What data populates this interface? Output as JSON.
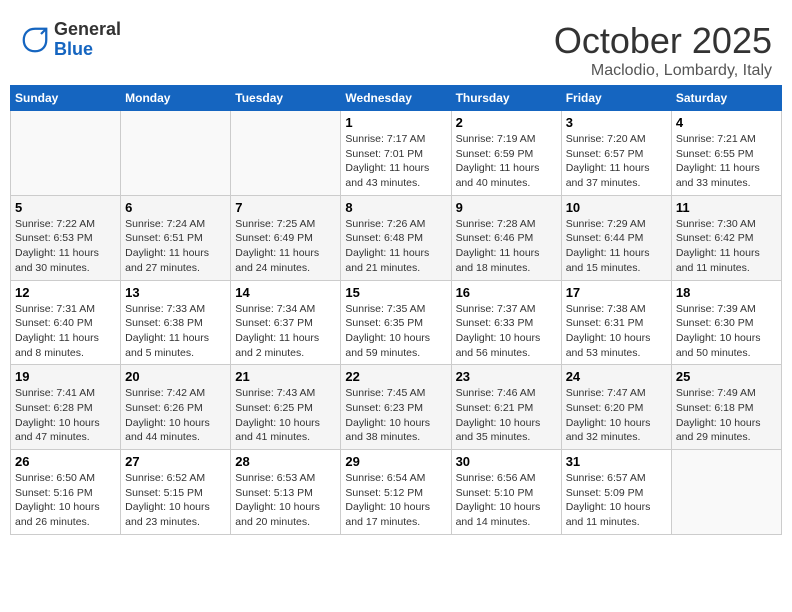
{
  "logo": {
    "general": "General",
    "blue": "Blue"
  },
  "title": "October 2025",
  "subtitle": "Maclodio, Lombardy, Italy",
  "days_of_week": [
    "Sunday",
    "Monday",
    "Tuesday",
    "Wednesday",
    "Thursday",
    "Friday",
    "Saturday"
  ],
  "weeks": [
    [
      {
        "day": "",
        "info": ""
      },
      {
        "day": "",
        "info": ""
      },
      {
        "day": "",
        "info": ""
      },
      {
        "day": "1",
        "info": "Sunrise: 7:17 AM\nSunset: 7:01 PM\nDaylight: 11 hours and 43 minutes."
      },
      {
        "day": "2",
        "info": "Sunrise: 7:19 AM\nSunset: 6:59 PM\nDaylight: 11 hours and 40 minutes."
      },
      {
        "day": "3",
        "info": "Sunrise: 7:20 AM\nSunset: 6:57 PM\nDaylight: 11 hours and 37 minutes."
      },
      {
        "day": "4",
        "info": "Sunrise: 7:21 AM\nSunset: 6:55 PM\nDaylight: 11 hours and 33 minutes."
      }
    ],
    [
      {
        "day": "5",
        "info": "Sunrise: 7:22 AM\nSunset: 6:53 PM\nDaylight: 11 hours and 30 minutes."
      },
      {
        "day": "6",
        "info": "Sunrise: 7:24 AM\nSunset: 6:51 PM\nDaylight: 11 hours and 27 minutes."
      },
      {
        "day": "7",
        "info": "Sunrise: 7:25 AM\nSunset: 6:49 PM\nDaylight: 11 hours and 24 minutes."
      },
      {
        "day": "8",
        "info": "Sunrise: 7:26 AM\nSunset: 6:48 PM\nDaylight: 11 hours and 21 minutes."
      },
      {
        "day": "9",
        "info": "Sunrise: 7:28 AM\nSunset: 6:46 PM\nDaylight: 11 hours and 18 minutes."
      },
      {
        "day": "10",
        "info": "Sunrise: 7:29 AM\nSunset: 6:44 PM\nDaylight: 11 hours and 15 minutes."
      },
      {
        "day": "11",
        "info": "Sunrise: 7:30 AM\nSunset: 6:42 PM\nDaylight: 11 hours and 11 minutes."
      }
    ],
    [
      {
        "day": "12",
        "info": "Sunrise: 7:31 AM\nSunset: 6:40 PM\nDaylight: 11 hours and 8 minutes."
      },
      {
        "day": "13",
        "info": "Sunrise: 7:33 AM\nSunset: 6:38 PM\nDaylight: 11 hours and 5 minutes."
      },
      {
        "day": "14",
        "info": "Sunrise: 7:34 AM\nSunset: 6:37 PM\nDaylight: 11 hours and 2 minutes."
      },
      {
        "day": "15",
        "info": "Sunrise: 7:35 AM\nSunset: 6:35 PM\nDaylight: 10 hours and 59 minutes."
      },
      {
        "day": "16",
        "info": "Sunrise: 7:37 AM\nSunset: 6:33 PM\nDaylight: 10 hours and 56 minutes."
      },
      {
        "day": "17",
        "info": "Sunrise: 7:38 AM\nSunset: 6:31 PM\nDaylight: 10 hours and 53 minutes."
      },
      {
        "day": "18",
        "info": "Sunrise: 7:39 AM\nSunset: 6:30 PM\nDaylight: 10 hours and 50 minutes."
      }
    ],
    [
      {
        "day": "19",
        "info": "Sunrise: 7:41 AM\nSunset: 6:28 PM\nDaylight: 10 hours and 47 minutes."
      },
      {
        "day": "20",
        "info": "Sunrise: 7:42 AM\nSunset: 6:26 PM\nDaylight: 10 hours and 44 minutes."
      },
      {
        "day": "21",
        "info": "Sunrise: 7:43 AM\nSunset: 6:25 PM\nDaylight: 10 hours and 41 minutes."
      },
      {
        "day": "22",
        "info": "Sunrise: 7:45 AM\nSunset: 6:23 PM\nDaylight: 10 hours and 38 minutes."
      },
      {
        "day": "23",
        "info": "Sunrise: 7:46 AM\nSunset: 6:21 PM\nDaylight: 10 hours and 35 minutes."
      },
      {
        "day": "24",
        "info": "Sunrise: 7:47 AM\nSunset: 6:20 PM\nDaylight: 10 hours and 32 minutes."
      },
      {
        "day": "25",
        "info": "Sunrise: 7:49 AM\nSunset: 6:18 PM\nDaylight: 10 hours and 29 minutes."
      }
    ],
    [
      {
        "day": "26",
        "info": "Sunrise: 6:50 AM\nSunset: 5:16 PM\nDaylight: 10 hours and 26 minutes."
      },
      {
        "day": "27",
        "info": "Sunrise: 6:52 AM\nSunset: 5:15 PM\nDaylight: 10 hours and 23 minutes."
      },
      {
        "day": "28",
        "info": "Sunrise: 6:53 AM\nSunset: 5:13 PM\nDaylight: 10 hours and 20 minutes."
      },
      {
        "day": "29",
        "info": "Sunrise: 6:54 AM\nSunset: 5:12 PM\nDaylight: 10 hours and 17 minutes."
      },
      {
        "day": "30",
        "info": "Sunrise: 6:56 AM\nSunset: 5:10 PM\nDaylight: 10 hours and 14 minutes."
      },
      {
        "day": "31",
        "info": "Sunrise: 6:57 AM\nSunset: 5:09 PM\nDaylight: 10 hours and 11 minutes."
      },
      {
        "day": "",
        "info": ""
      }
    ]
  ]
}
